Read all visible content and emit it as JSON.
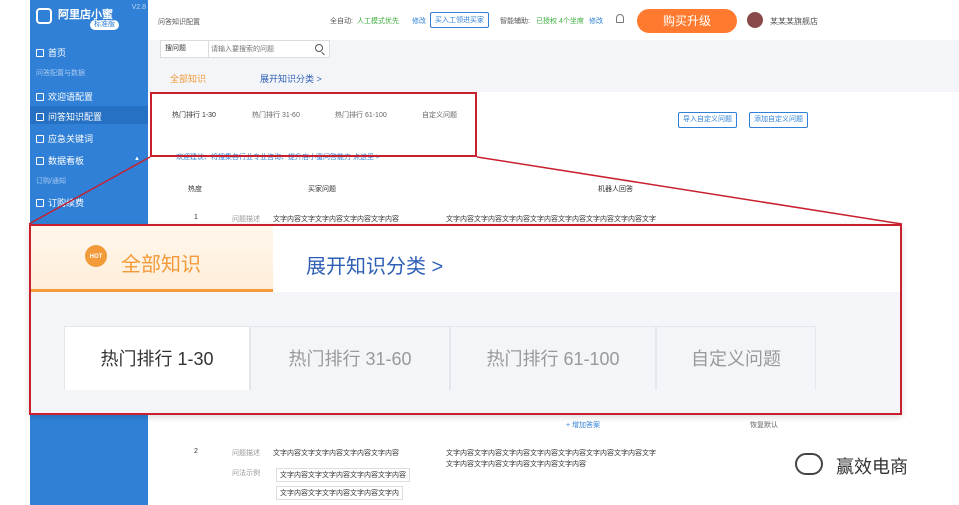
{
  "sidebar": {
    "app_title": "阿里店小蜜",
    "badge": "标准版",
    "version": "V2.8",
    "items": [
      {
        "label": "首页"
      },
      {
        "label": "欢迎语配置"
      },
      {
        "label": "问答知识配置"
      },
      {
        "label": "应急关键词"
      },
      {
        "label": "数据看板"
      },
      {
        "label": "订购续费"
      }
    ],
    "groups": [
      {
        "label": "问答配置与数据"
      },
      {
        "label": "订购/通知"
      }
    ]
  },
  "header": {
    "page_title": "问答知识配置",
    "auto_label": "全自动:",
    "auto_value": "人工模式优先",
    "modify_1": "修改",
    "human_buy": "买入工领进买家",
    "assist_label": "智能辅助:",
    "assist_value": "已授权 4个坐席",
    "modify_2": "修改",
    "buy_button": "购买升级",
    "store_name": "某某某旗舰店"
  },
  "search": {
    "select_value": "搜问题",
    "placeholder": "请输入要搜索的问题"
  },
  "categories": {
    "all": "全部知识",
    "expand": "展开知识分类 >",
    "hot_badge": "HOT"
  },
  "tabs": [
    {
      "label": "热门排行 1-30"
    },
    {
      "label": "热门排行 31-60"
    },
    {
      "label": "热门排行 61-100"
    },
    {
      "label": "自定义问题"
    }
  ],
  "buttons": {
    "import": "导入自定义问题",
    "add": "添加自定义问题"
  },
  "tip": "欢迎建议、将搜集各行业专业咨询、提升店小蜜问答能力 点这里 >",
  "table": {
    "col_heat": "热度",
    "col_question": "买家问题",
    "col_answer": "机器人回答",
    "rows": [
      {
        "rank": "1",
        "q_label": "问题描述",
        "q": "文字内容文字文字内容文字内容文字内容",
        "a": "文字内容文字内容文字内容文字内容文字内容文字内容文字内容文字"
      },
      {
        "rank": "2",
        "q_label": "问题描述",
        "q": "文字内容文字文字内容文字内容文字内容",
        "a": "文字内容文字内容文字内容文字内容文字内容文字内容文字内容文字"
      }
    ],
    "row2_a_line2": "文字内容文字内容文字内容文字内容文字内容",
    "row2_example_label": "问法示例",
    "row2_example_1": "文字内容文字文字内容文字内容文字内容",
    "row2_example_2": "文字内容文字文字内容文字内容文字内",
    "add_answer": "+ 增加答案",
    "restore_default": "恢复默认"
  },
  "watermark": "赢效电商"
}
